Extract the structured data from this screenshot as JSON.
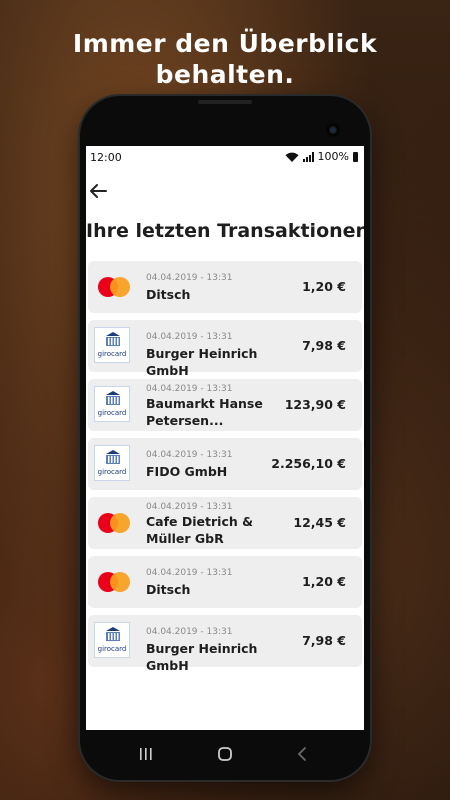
{
  "headline": {
    "line1": "Immer den Überblick",
    "line2": "behalten."
  },
  "status": {
    "time": "12:00",
    "battery": "100%",
    "icons": [
      "wifi-icon",
      "signal-icon",
      "battery-icon"
    ]
  },
  "screen": {
    "back_icon": "arrow-left-icon",
    "title": "Ihre letzten Transaktionen"
  },
  "card_brands": {
    "girocard": "girocard"
  },
  "transactions": [
    {
      "logo": "mastercard",
      "date": "04.04.2019 - 13:31",
      "merchant": "Ditsch",
      "amount": "1,20 €"
    },
    {
      "logo": "girocard",
      "date": "04.04.2019 - 13:31",
      "merchant": "Burger Heinrich GmbH",
      "amount": "7,98 €"
    },
    {
      "logo": "girocard",
      "date": "04.04.2019 - 13:31",
      "merchant": "Baumarkt Hanse Petersen...",
      "amount": "123,90 €"
    },
    {
      "logo": "girocard",
      "date": "04.04.2019 - 13:31",
      "merchant": "FIDO GmbH",
      "amount": "2.256,10 €"
    },
    {
      "logo": "mastercard",
      "date": "04.04.2019 - 13:31",
      "merchant": "Cafe Dietrich & Müller GbR",
      "amount": "12,45 €"
    },
    {
      "logo": "mastercard",
      "date": "04.04.2019 - 13:31",
      "merchant": "Ditsch",
      "amount": "1,20 €"
    },
    {
      "logo": "girocard",
      "date": "04.04.2019 - 13:31",
      "merchant": "Burger Heinrich GmbH",
      "amount": "7,98 €"
    }
  ],
  "navbar": {
    "buttons": [
      "recent-apps-icon",
      "home-icon",
      "back-icon"
    ]
  },
  "colors": {
    "mastercard_red": "#eb001b",
    "mastercard_orange": "#f79e1b",
    "card_bg": "#eeeeee",
    "girocard_blue": "#1a3d7a"
  }
}
